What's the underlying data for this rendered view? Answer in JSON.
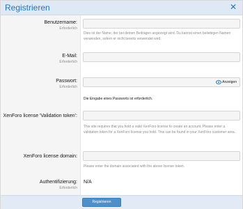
{
  "dialog": {
    "title": "Registrieren",
    "close_icon": "close-icon"
  },
  "form": {
    "username": {
      "label": "Benutzername:",
      "hint": "Erforderlich",
      "value": "",
      "explain": "Dies ist der Name, der bei deinen Beiträgen angezeigt wird. Du kannst einen beliebigen Namen verwenden, sofern er nicht bereits verwendet wird."
    },
    "email": {
      "label": "E-Mail:",
      "hint": "Erforderlich",
      "value": ""
    },
    "password": {
      "label": "Passwort:",
      "hint": "Erforderlich",
      "value": "",
      "show_label": "Anzeigen",
      "show_icon": "eye-icon",
      "error": "Die Eingabe eines Passworts ist erforderlich."
    },
    "token": {
      "label": "XenForo license 'Validation token':",
      "value": "",
      "explain": "This site requires that you hold a valid XenForo license to create an account. Please enter a validation token for a XenForo license you hold. This can be found in your XenForo customer area."
    },
    "domain": {
      "label": "XenForo license domain:",
      "value": "",
      "explain": "Please enter the domain associated with the above license token."
    },
    "auth": {
      "label": "Authentifizierung:",
      "hint": "Erforderlich",
      "value": "N/A"
    }
  },
  "footer": {
    "submit_label": "Registrieren"
  },
  "colors": {
    "accent": "#2577b1",
    "title_bar": "#dfe9f5",
    "button": "#4f8fc8"
  }
}
